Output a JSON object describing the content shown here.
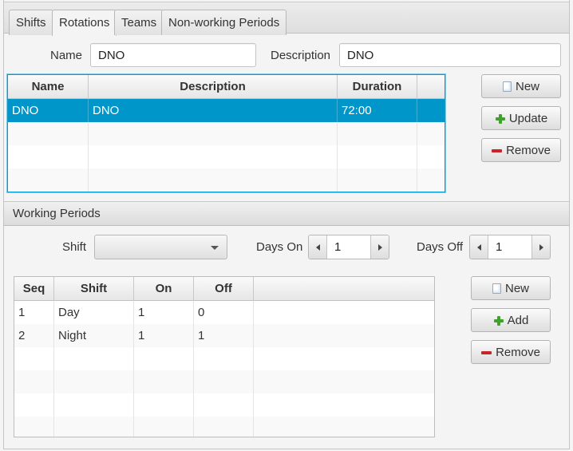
{
  "tabs": [
    {
      "label": "Shifts",
      "active": false
    },
    {
      "label": "Rotations",
      "active": true
    },
    {
      "label": "Teams",
      "active": false
    },
    {
      "label": "Non-working Periods",
      "active": false
    }
  ],
  "rotation_form": {
    "name_label": "Name",
    "name_value": "DNO",
    "description_label": "Description",
    "description_value": "DNO"
  },
  "rotations_table": {
    "columns": [
      "Name",
      "Description",
      "Duration",
      ""
    ],
    "rows": [
      {
        "name": "DNO",
        "description": "DNO",
        "duration": "72:00",
        "selected": true
      }
    ]
  },
  "rotation_buttons": {
    "new": "New",
    "update": "Update",
    "remove": "Remove"
  },
  "working_periods": {
    "section_title": "Working Periods",
    "shift_label": "Shift",
    "shift_value": "",
    "days_on_label": "Days On",
    "days_on_value": "1",
    "days_off_label": "Days Off",
    "days_off_value": "1",
    "columns": [
      "Seq",
      "Shift",
      "On",
      "Off",
      ""
    ],
    "rows": [
      {
        "seq": "1",
        "shift": "Day",
        "on": "1",
        "off": "0"
      },
      {
        "seq": "2",
        "shift": "Night",
        "on": "1",
        "off": "1"
      }
    ],
    "buttons": {
      "new": "New",
      "add": "Add",
      "remove": "Remove"
    }
  },
  "colors": {
    "selection": "#0096c9",
    "focus_border": "#039ed3",
    "add_icon": "#3ea22b",
    "remove_icon": "#c8252b"
  }
}
